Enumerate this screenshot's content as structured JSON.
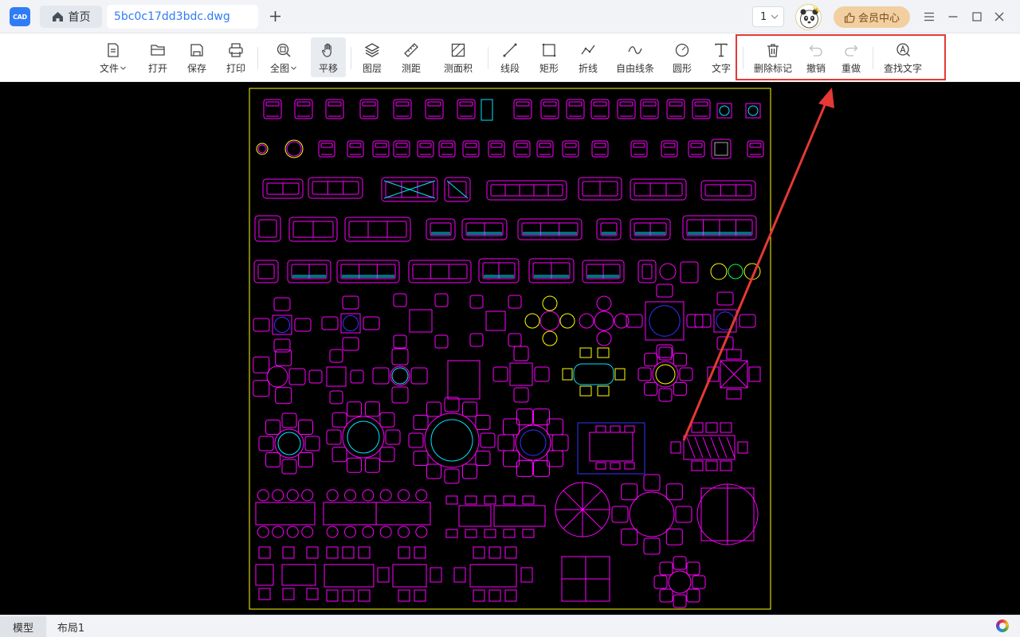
{
  "app": {
    "logo_text": "CAD"
  },
  "tabs": {
    "home_label": "首页",
    "file_label": "5bc0c17dd3bdc.dwg"
  },
  "header": {
    "page_select_value": "1",
    "vip_label": "会员中心"
  },
  "toolbar": {
    "items": [
      {
        "label": "文件",
        "icon": "file-icon"
      },
      {
        "label": "打开",
        "icon": "folder-open-icon"
      },
      {
        "label": "保存",
        "icon": "save-icon"
      },
      {
        "label": "打印",
        "icon": "printer-icon"
      },
      {
        "label": "全图",
        "icon": "zoom-extent-icon"
      },
      {
        "label": "平移",
        "icon": "hand-pan-icon"
      },
      {
        "label": "图层",
        "icon": "layers-icon"
      },
      {
        "label": "测距",
        "icon": "ruler-icon"
      },
      {
        "label": "测面积",
        "icon": "area-measure-icon"
      },
      {
        "label": "线段",
        "icon": "line-segment-icon"
      },
      {
        "label": "矩形",
        "icon": "rectangle-icon"
      },
      {
        "label": "折线",
        "icon": "polyline-icon"
      },
      {
        "label": "自由线条",
        "icon": "freehand-icon"
      },
      {
        "label": "圆形",
        "icon": "circle-icon"
      },
      {
        "label": "文字",
        "icon": "text-icon"
      },
      {
        "label": "删除标记",
        "icon": "trash-icon"
      },
      {
        "label": "撤销",
        "icon": "undo-icon"
      },
      {
        "label": "重做",
        "icon": "redo-icon"
      },
      {
        "label": "查找文字",
        "icon": "find-text-icon"
      }
    ]
  },
  "layout_tabs": {
    "model_label": "模型",
    "layout1_label": "布局1"
  },
  "colors": {
    "accent": "#2f7cf6",
    "drawing_frame": "#ffff00",
    "drawing_lines": "#ff00ff",
    "annotation": "#e53935"
  }
}
